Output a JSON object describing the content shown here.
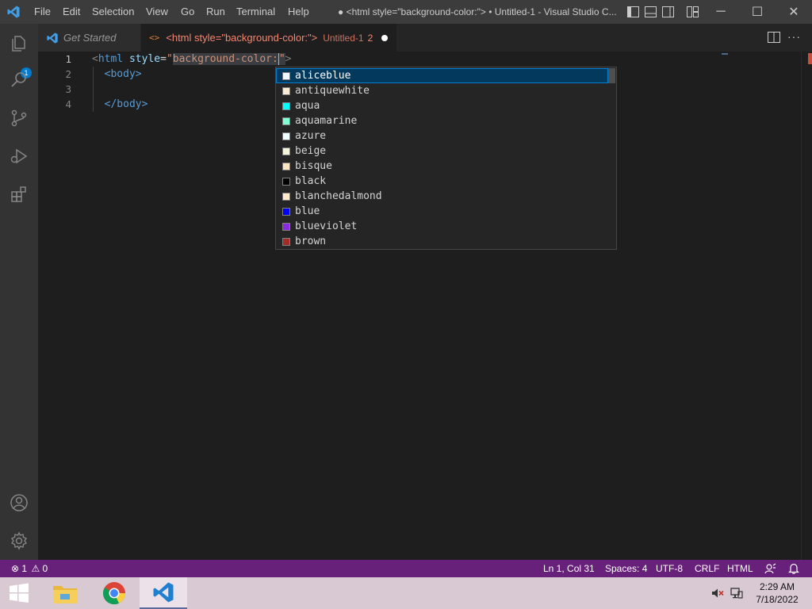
{
  "titlebar": {
    "menu": [
      "File",
      "Edit",
      "Selection",
      "View",
      "Go",
      "Run",
      "Terminal",
      "Help"
    ],
    "title": "● <html style=\"background-color:\"> • Untitled-1 - Visual Studio C...",
    "controls": {
      "minimize": "─",
      "maximize": "☐",
      "close": "✕"
    }
  },
  "activitybar": {
    "icons": [
      "explorer-icon",
      "search-icon",
      "source-control-icon",
      "run-debug-icon",
      "extensions-icon",
      "accounts-icon",
      "settings-gear-icon"
    ],
    "explorer_badge": "1"
  },
  "tabs": [
    {
      "label": "Get Started",
      "icon": "vscode-icon",
      "active": false
    },
    {
      "label": "<html style=\"background-color:\">",
      "file": "Untitled-1",
      "problems": "2",
      "dirty": true,
      "active": true
    }
  ],
  "editor": {
    "line_numbers": [
      "1",
      "2",
      "3",
      "4"
    ],
    "lines": [
      {
        "open": "<",
        "tag": "html",
        "space": " ",
        "attr": "style",
        "eq": "=",
        "quote": "\"",
        "value": "background-color:",
        "quote2": "\"",
        "close": ">"
      },
      {
        "indent": "  ",
        "text": "<body>"
      },
      {
        "text": ""
      },
      {
        "indent": "  ",
        "text": "</body>"
      }
    ]
  },
  "suggestions": {
    "selected_index": 0,
    "items": [
      {
        "label": "aliceblue",
        "color": "#f0f8ff"
      },
      {
        "label": "antiquewhite",
        "color": "#faebd7"
      },
      {
        "label": "aqua",
        "color": "#00ffff"
      },
      {
        "label": "aquamarine",
        "color": "#7fffd4"
      },
      {
        "label": "azure",
        "color": "#f0ffff"
      },
      {
        "label": "beige",
        "color": "#f5f5dc"
      },
      {
        "label": "bisque",
        "color": "#ffe4c4"
      },
      {
        "label": "black",
        "color": "#000000"
      },
      {
        "label": "blanchedalmond",
        "color": "#ffebcd"
      },
      {
        "label": "blue",
        "color": "#0000ff"
      },
      {
        "label": "blueviolet",
        "color": "#8a2be2"
      },
      {
        "label": "brown",
        "color": "#a52a2a"
      }
    ]
  },
  "statusbar": {
    "errors": "1",
    "warnings": "0",
    "position": "Ln 1, Col 31",
    "spaces": "Spaces: 4",
    "encoding": "UTF-8",
    "eol": "CRLF",
    "language": "HTML"
  },
  "taskbar": {
    "apps": [
      "windows-start-icon",
      "file-explorer-icon",
      "chrome-icon",
      "vscode-icon"
    ],
    "time": "2:29 AM",
    "date": "7/18/2022"
  },
  "colors": {
    "titlebar": "#3c3c3c",
    "activitybar": "#333333",
    "editor_bg": "#1e1e1e",
    "statusbar": "#68217a",
    "accent": "#007fd4"
  }
}
